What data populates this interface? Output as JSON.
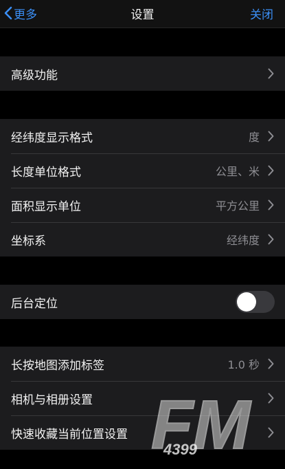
{
  "colors": {
    "accent": "#3b8ff6",
    "background": "#000000",
    "cell_background": "#1c1c1e",
    "secondary_text": "#8e8e93"
  },
  "nav": {
    "back_label": "更多",
    "title": "设置",
    "close_label": "关闭"
  },
  "groups": {
    "advanced": {
      "rows": [
        {
          "label": "高级功能",
          "value": "",
          "icon": "chevron-right-icon"
        }
      ]
    },
    "format": {
      "rows": [
        {
          "label": "经纬度显示格式",
          "value": "度",
          "icon": "chevron-right-icon"
        },
        {
          "label": "长度单位格式",
          "value": "公里、米",
          "icon": "chevron-right-icon"
        },
        {
          "label": "面积显示单位",
          "value": "平方公里",
          "icon": "chevron-right-icon"
        },
        {
          "label": "坐标系",
          "value": "经纬度",
          "icon": "chevron-right-icon"
        }
      ]
    },
    "background": {
      "rows": [
        {
          "label": "后台定位",
          "toggle_on": false
        }
      ]
    },
    "misc": {
      "rows": [
        {
          "label": "长按地图添加标签",
          "value": "1.0 秒",
          "icon": "chevron-right-icon"
        },
        {
          "label": "相机与相册设置",
          "value": "",
          "icon": "chevron-right-icon"
        },
        {
          "label": "快速收藏当前位置设置",
          "value": "",
          "icon": "chevron-right-icon"
        }
      ]
    }
  },
  "watermark": {
    "logo_text": "FM",
    "logo_subtext": "4399"
  }
}
